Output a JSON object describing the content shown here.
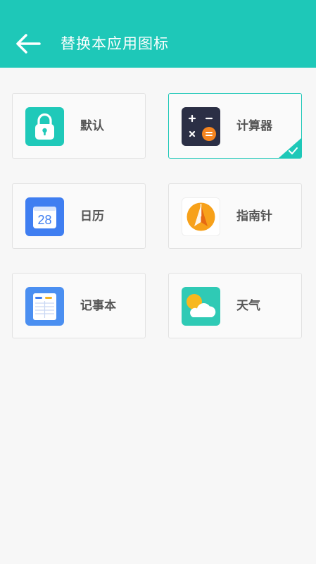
{
  "header": {
    "title": "替换本应用图标",
    "back_icon": "arrow-left-icon",
    "bg_color": "#1ec8b8"
  },
  "icons": [
    {
      "label": "默认",
      "icon": "lock-icon",
      "selected": false
    },
    {
      "label": "计算器",
      "icon": "calculator-icon",
      "selected": true
    },
    {
      "label": "日历",
      "icon": "calendar-icon",
      "day": "28",
      "selected": false
    },
    {
      "label": "指南针",
      "icon": "compass-icon",
      "selected": false
    },
    {
      "label": "记事本",
      "icon": "notepad-icon",
      "selected": false
    },
    {
      "label": "天气",
      "icon": "weather-icon",
      "selected": false
    }
  ],
  "accent_color": "#1ec8b8"
}
